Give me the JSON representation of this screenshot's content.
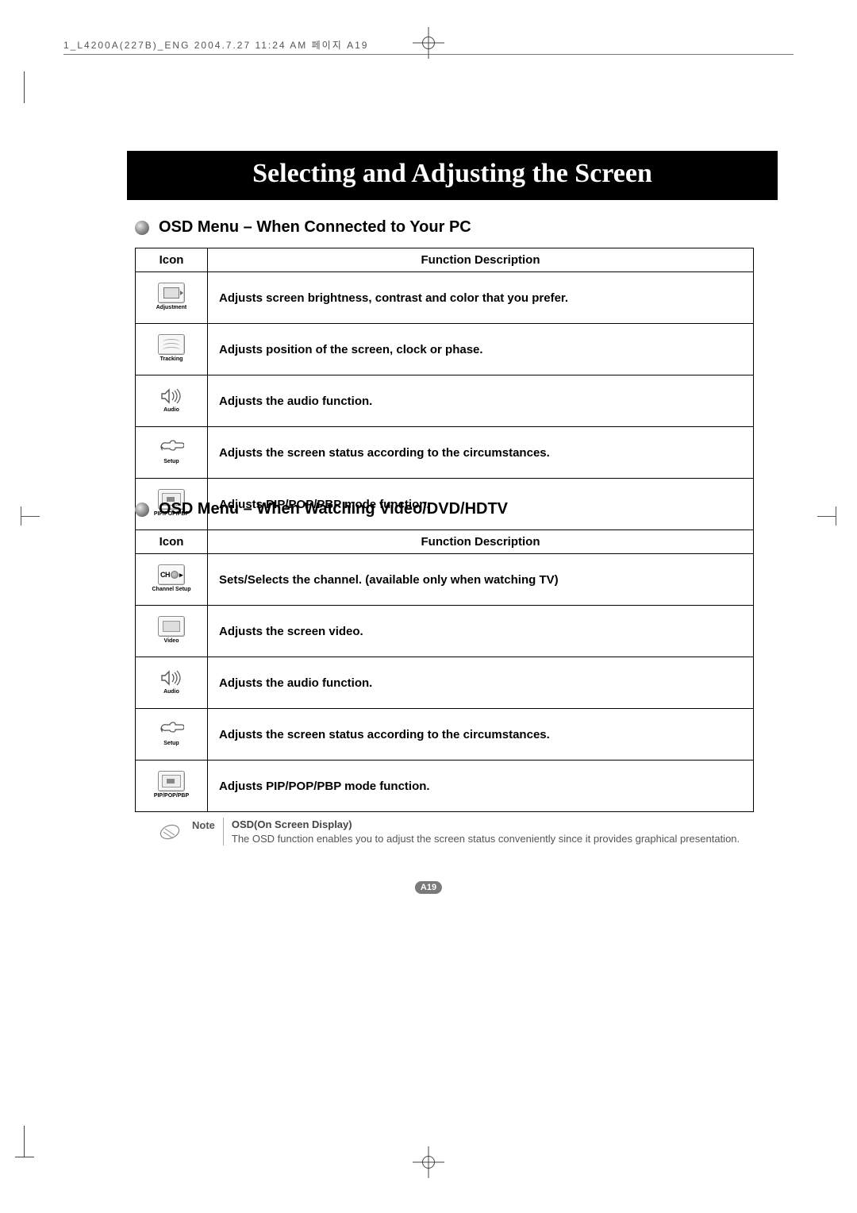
{
  "meta_header": "1_L4200A(227B)_ENG  2004.7.27  11:24 AM  페이지  A19",
  "page_title": "Selecting and Adjusting the Screen",
  "page_number": "A19",
  "section1": {
    "heading": "OSD Menu – When Connected to Your PC",
    "col_icon": "Icon",
    "col_desc": "Function Description",
    "rows": [
      {
        "icon_label": "Adjustment",
        "desc": "Adjusts screen brightness, contrast and color that you prefer."
      },
      {
        "icon_label": "Tracking",
        "desc": "Adjusts position of the screen, clock or phase."
      },
      {
        "icon_label": "Audio",
        "desc": "Adjusts the audio function."
      },
      {
        "icon_label": "Setup",
        "desc": "Adjusts the screen status according to the circumstances."
      },
      {
        "icon_label": "PIP/POP/PBP",
        "desc": "Adjusts PIP/POP/PBP mode function."
      }
    ]
  },
  "section2": {
    "heading": "OSD Menu – When Watching Video/DVD/HDTV",
    "col_icon": "Icon",
    "col_desc": "Function Description",
    "rows": [
      {
        "icon_label": "Channel Setup",
        "desc": "Sets/Selects the channel. (available only when watching TV)"
      },
      {
        "icon_label": "Video",
        "desc": "Adjusts the screen video."
      },
      {
        "icon_label": "Audio",
        "desc": "Adjusts the audio function."
      },
      {
        "icon_label": "Setup",
        "desc": "Adjusts the screen status according to the circumstances."
      },
      {
        "icon_label": "PIP/POP/PBP",
        "desc": "Adjusts PIP/POP/PBP mode function."
      }
    ]
  },
  "note": {
    "label": "Note",
    "title": "OSD(On Screen Display)",
    "body": "The OSD function enables you to adjust the screen status conveniently since it provides graphical presentation."
  }
}
